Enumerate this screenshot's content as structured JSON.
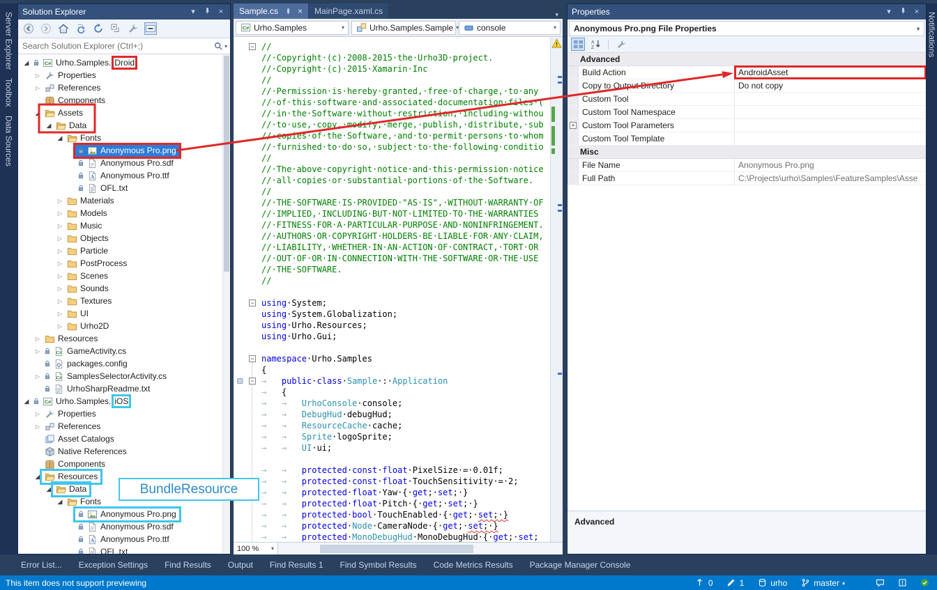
{
  "colors": {
    "chrome": "#29405F",
    "chrome_dark": "#1D3254",
    "titlebar": "#33517C",
    "statusbar": "#0079CC",
    "selection": "#2E7CD7",
    "annotation_red": "#E12727",
    "annotation_cyan": "#3FC6EC",
    "keyword_blue": "#0000EE",
    "type_teal": "#2B91AF",
    "comment_green": "#008000"
  },
  "glyphs": {
    "expanded": "◢",
    "collapsed": "▷",
    "caret_down": "▾",
    "caret_up": "▴",
    "fold": "−",
    "plus": "+",
    "close": "×",
    "window_position": "▾"
  },
  "side_tabs": {
    "left": [
      "Server Explorer",
      "Toolbox",
      "Data Sources"
    ],
    "right": [
      "Notifications"
    ]
  },
  "panel_buttons": [
    {
      "name": "window-position",
      "glyph": "▾"
    },
    {
      "name": "pin",
      "icon": "pin"
    },
    {
      "name": "close",
      "glyph": "×"
    }
  ],
  "solution_explorer": {
    "title": "Solution Explorer",
    "search_placeholder": "Search Solution Explorer (Ctrl+;)",
    "toolbar": [
      {
        "name": "back",
        "icon": "back"
      },
      {
        "name": "forward",
        "icon": "forward"
      },
      {
        "name": "home",
        "icon": "home"
      },
      {
        "name": "sync-with-active-document",
        "icon": "sync"
      },
      {
        "name": "refresh",
        "icon": "refresh"
      },
      {
        "name": "collapse-all",
        "icon": "collapse"
      },
      {
        "name": "properties",
        "icon": "wrench"
      },
      {
        "name": "preview-selected-items",
        "icon": "dash"
      }
    ],
    "tree": [
      {
        "label": "Urho.Samples.",
        "suffix": "Droid",
        "suffix_box": "red",
        "depth": 0,
        "icon": "proj",
        "exp": "open",
        "lock": 1
      },
      {
        "label": "Properties",
        "depth": 1,
        "icon": "wrench",
        "exp": "closed"
      },
      {
        "label": "References",
        "depth": 1,
        "icon": "refs",
        "exp": "closed"
      },
      {
        "label": "Components",
        "depth": 1,
        "icon": "package"
      },
      {
        "label": "Assets",
        "depth": 1,
        "icon": "folder-open",
        "exp": "open"
      },
      {
        "label": "Data",
        "depth": 2,
        "icon": "folder-open",
        "exp": "open"
      },
      {
        "label": "Fonts",
        "depth": 3,
        "icon": "folder-open",
        "exp": "open"
      },
      {
        "label": "Anonymous Pro.png",
        "depth": 4,
        "icon": "image",
        "lock": 1,
        "selected": 1,
        "box": "red"
      },
      {
        "label": "Anonymous Pro.sdf",
        "depth": 4,
        "icon": "file",
        "lock": 1
      },
      {
        "label": "Anonymous Pro.ttf",
        "depth": 4,
        "icon": "fontfile",
        "lock": 1
      },
      {
        "label": "OFL.txt",
        "depth": 4,
        "icon": "text",
        "lock": 1
      },
      {
        "label": "Materials",
        "depth": 3,
        "icon": "folder",
        "exp": "closed"
      },
      {
        "label": "Models",
        "depth": 3,
        "icon": "folder",
        "exp": "closed"
      },
      {
        "label": "Music",
        "depth": 3,
        "icon": "folder",
        "exp": "closed"
      },
      {
        "label": "Objects",
        "depth": 3,
        "icon": "folder",
        "exp": "closed"
      },
      {
        "label": "Particle",
        "depth": 3,
        "icon": "folder",
        "exp": "closed"
      },
      {
        "label": "PostProcess",
        "depth": 3,
        "icon": "folder",
        "exp": "closed"
      },
      {
        "label": "Scenes",
        "depth": 3,
        "icon": "folder",
        "exp": "closed"
      },
      {
        "label": "Sounds",
        "depth": 3,
        "icon": "folder",
        "exp": "closed"
      },
      {
        "label": "Textures",
        "depth": 3,
        "icon": "folder",
        "exp": "closed"
      },
      {
        "label": "UI",
        "depth": 3,
        "icon": "folder",
        "exp": "closed"
      },
      {
        "label": "Urho2D",
        "depth": 3,
        "icon": "folder",
        "exp": "closed"
      },
      {
        "label": "Resources",
        "depth": 1,
        "icon": "folder",
        "exp": "closed"
      },
      {
        "label": "GameActivity.cs",
        "depth": 1,
        "icon": "cs",
        "exp": "closed",
        "lock": 1
      },
      {
        "label": "packages.config",
        "depth": 1,
        "icon": "config",
        "lock": 1
      },
      {
        "label": "SamplesSelectorActivity.cs",
        "depth": 1,
        "icon": "cs",
        "exp": "closed",
        "lock": 1
      },
      {
        "label": "UrhoSharpReadme.txt",
        "depth": 1,
        "icon": "text",
        "lock": 1
      },
      {
        "label": "Urho.Samples.",
        "suffix": "iOS",
        "suffix_box": "cyan",
        "depth": 0,
        "icon": "proj",
        "exp": "open",
        "lock": 1
      },
      {
        "label": "Properties",
        "depth": 1,
        "icon": "wrench",
        "exp": "closed"
      },
      {
        "label": "References",
        "depth": 1,
        "icon": "refs",
        "exp": "closed"
      },
      {
        "label": "Asset Catalogs",
        "depth": 1,
        "icon": "catalog"
      },
      {
        "label": "Native References",
        "depth": 1,
        "icon": "cube"
      },
      {
        "label": "Components",
        "depth": 1,
        "icon": "package"
      },
      {
        "label": "Resources",
        "depth": 1,
        "icon": "folder-open",
        "exp": "open",
        "box": "cyan"
      },
      {
        "label": "Data",
        "depth": 2,
        "icon": "folder-open",
        "exp": "open",
        "box": "cyan"
      },
      {
        "label": "Fonts",
        "depth": 3,
        "icon": "folder-open",
        "exp": "open"
      },
      {
        "label": "Anonymous Pro.png",
        "depth": 4,
        "icon": "image",
        "lock": 1,
        "box": "cyan"
      },
      {
        "label": "Anonymous Pro.sdf",
        "depth": 4,
        "icon": "file",
        "lock": 1
      },
      {
        "label": "Anonymous Pro.ttf",
        "depth": 4,
        "icon": "fontfile",
        "lock": 1
      },
      {
        "label": "OFL.txt",
        "depth": 4,
        "icon": "text",
        "lock": 1
      }
    ]
  },
  "editor": {
    "tabs": [
      {
        "label": "Sample.cs",
        "active": true
      },
      {
        "label": "MainPage.xaml.cs",
        "active": false
      }
    ],
    "navbar": [
      {
        "name": "project",
        "icon": "proj",
        "label": "Urho.Samples"
      },
      {
        "name": "type",
        "icon": "class",
        "label": "Urho.Samples.Sample"
      },
      {
        "name": "member",
        "icon": "field",
        "label": "console"
      }
    ],
    "zoom": "100 %",
    "code": [
      {
        "f": 1,
        "s": [
          [
            "cm",
            "//"
          ]
        ]
      },
      {
        "s": [
          [
            "cm",
            "//·Copyright·(c)·2008-2015·the·Urho3D·project."
          ]
        ]
      },
      {
        "s": [
          [
            "cm",
            "//·Copyright·(c)·2015·Xamarin·Inc"
          ]
        ]
      },
      {
        "s": [
          [
            "cm",
            "//"
          ]
        ]
      },
      {
        "s": [
          [
            "cm",
            "//·Permission·is·hereby·granted,·free·of·charge,·to·any"
          ]
        ]
      },
      {
        "s": [
          [
            "cm",
            "//·of·this·software·and·associated·documentation·files·("
          ]
        ]
      },
      {
        "s": [
          [
            "cm",
            "//·in·the·Software·without·restriction,·including·withou"
          ]
        ]
      },
      {
        "s": [
          [
            "cm",
            "//·to·use,·copy,·modify,·merge,·publish,·distribute,·sub"
          ]
        ]
      },
      {
        "s": [
          [
            "cm",
            "//·copies·of·the·Software,·and·to·permit·persons·to·whom"
          ]
        ]
      },
      {
        "s": [
          [
            "cm",
            "//·furnished·to·do·so,·subject·to·the·following·conditio"
          ]
        ]
      },
      {
        "s": [
          [
            "cm",
            "//"
          ]
        ]
      },
      {
        "s": [
          [
            "cm",
            "//·The·above·copyright·notice·and·this·permission·notice"
          ]
        ]
      },
      {
        "s": [
          [
            "cm",
            "//·all·copies·or·substantial·portions·of·the·Software."
          ]
        ]
      },
      {
        "s": [
          [
            "cm",
            "//"
          ]
        ]
      },
      {
        "s": [
          [
            "cm",
            "//·THE·SOFTWARE·IS·PROVIDED·\"AS·IS\",·WITHOUT·WARRANTY·OF"
          ]
        ]
      },
      {
        "s": [
          [
            "cm",
            "//·IMPLIED,·INCLUDING·BUT·NOT·LIMITED·TO·THE·WARRANTIES"
          ]
        ]
      },
      {
        "s": [
          [
            "cm",
            "//·FITNESS·FOR·A·PARTICULAR·PURPOSE·AND·NONINFRINGEMENT."
          ]
        ]
      },
      {
        "s": [
          [
            "cm",
            "//·AUTHORS·OR·COPYRIGHT·HOLDERS·BE·LIABLE·FOR·ANY·CLAIM,"
          ]
        ]
      },
      {
        "s": [
          [
            "cm",
            "//·LIABILITY,·WHETHER·IN·AN·ACTION·OF·CONTRACT,·TORT·OR"
          ]
        ]
      },
      {
        "s": [
          [
            "cm",
            "//·OUT·OF·OR·IN·CONNECTION·WITH·THE·SOFTWARE·OR·THE·USE"
          ]
        ]
      },
      {
        "s": [
          [
            "cm",
            "//·THE·SOFTWARE."
          ]
        ]
      },
      {
        "s": [
          [
            "cm",
            "//"
          ]
        ]
      },
      {
        "s": []
      },
      {
        "f": 1,
        "s": [
          [
            "kw",
            "using"
          ],
          [
            "tx",
            "·System;"
          ]
        ]
      },
      {
        "s": [
          [
            "kw",
            "using"
          ],
          [
            "tx",
            "·System.Globalization;"
          ]
        ]
      },
      {
        "s": [
          [
            "kw",
            "using"
          ],
          [
            "tx",
            "·Urho.Resources;"
          ]
        ]
      },
      {
        "s": [
          [
            "kw",
            "using"
          ],
          [
            "tx",
            "·Urho.Gui;"
          ]
        ]
      },
      {
        "s": []
      },
      {
        "f": 1,
        "s": [
          [
            "kw",
            "namespace"
          ],
          [
            "tx",
            "·Urho.Samples"
          ]
        ]
      },
      {
        "s": [
          [
            "tx",
            "{"
          ]
        ]
      },
      {
        "f": 1,
        "g": 1,
        "s": [
          [
            "ws",
            "→   "
          ],
          [
            "kw",
            "public"
          ],
          [
            "tx",
            "·"
          ],
          [
            "kw",
            "class"
          ],
          [
            "tx",
            "·"
          ],
          [
            "ty",
            "Sample"
          ],
          [
            "tx",
            "·:·"
          ],
          [
            "ty",
            "Application"
          ]
        ]
      },
      {
        "s": [
          [
            "ws",
            "→   "
          ],
          [
            "tx",
            "{"
          ]
        ]
      },
      {
        "s": [
          [
            "ws",
            "→   →   "
          ],
          [
            "ty",
            "UrhoConsole"
          ],
          [
            "tx",
            "·console;"
          ]
        ]
      },
      {
        "s": [
          [
            "ws",
            "→   →   "
          ],
          [
            "ty",
            "DebugHud"
          ],
          [
            "tx",
            "·debugHud;"
          ]
        ]
      },
      {
        "s": [
          [
            "ws",
            "→   →   "
          ],
          [
            "ty",
            "ResourceCache"
          ],
          [
            "tx",
            "·cache;"
          ]
        ]
      },
      {
        "s": [
          [
            "ws",
            "→   →   "
          ],
          [
            "ty",
            "Sprite"
          ],
          [
            "tx",
            "·logoSprite;"
          ]
        ]
      },
      {
        "s": [
          [
            "ws",
            "→   →   "
          ],
          [
            "ty",
            "UI"
          ],
          [
            "tx",
            "·ui;"
          ]
        ]
      },
      {
        "s": []
      },
      {
        "s": [
          [
            "ws",
            "→   →   "
          ],
          [
            "kw",
            "protected"
          ],
          [
            "tx",
            "·"
          ],
          [
            "kw",
            "const"
          ],
          [
            "tx",
            "·"
          ],
          [
            "kw",
            "float"
          ],
          [
            "tx",
            "·PixelSize·=·0.01f;"
          ]
        ]
      },
      {
        "s": [
          [
            "ws",
            "→   →   "
          ],
          [
            "kw",
            "protected"
          ],
          [
            "tx",
            "·"
          ],
          [
            "kw",
            "const"
          ],
          [
            "tx",
            "·"
          ],
          [
            "kw",
            "float"
          ],
          [
            "tx",
            "·TouchSensitivity·=·2;"
          ]
        ]
      },
      {
        "s": [
          [
            "ws",
            "→   →   "
          ],
          [
            "kw",
            "protected"
          ],
          [
            "tx",
            "·"
          ],
          [
            "kw",
            "float"
          ],
          [
            "tx",
            "·Yaw·{·"
          ],
          [
            "kw",
            "get"
          ],
          [
            "tx",
            ";·"
          ],
          [
            "kw",
            "set"
          ],
          [
            "tx",
            ";·}"
          ]
        ]
      },
      {
        "s": [
          [
            "ws",
            "→   →   "
          ],
          [
            "kw",
            "protected"
          ],
          [
            "tx",
            "·"
          ],
          [
            "kw",
            "float"
          ],
          [
            "tx",
            "·Pitch·{·"
          ],
          [
            "kw",
            "get"
          ],
          [
            "tx",
            ";·"
          ],
          [
            "kw",
            "set"
          ],
          [
            "tx",
            ";·}"
          ]
        ]
      },
      {
        "s": [
          [
            "ws",
            "→   →   "
          ],
          [
            "kw",
            "protected"
          ],
          [
            "tx",
            "·"
          ],
          [
            "kw",
            "bool"
          ],
          [
            "tx",
            "·TouchEnabled·{·"
          ],
          [
            "kw",
            "get"
          ],
          [
            "tx",
            ";·"
          ],
          [
            "kw sq",
            "set"
          ],
          [
            "tx sq",
            ";·}"
          ]
        ]
      },
      {
        "s": [
          [
            "ws",
            "→   →   "
          ],
          [
            "kw",
            "protected"
          ],
          [
            "tx",
            "·"
          ],
          [
            "ty",
            "Node"
          ],
          [
            "tx",
            "·CameraNode·{·"
          ],
          [
            "kw",
            "get"
          ],
          [
            "tx",
            ";·"
          ],
          [
            "kw sq",
            "set"
          ],
          [
            "tx sq",
            ";·}"
          ]
        ]
      },
      {
        "s": [
          [
            "ws",
            "→   →   "
          ],
          [
            "kw sq",
            "protected"
          ],
          [
            "tx",
            "·"
          ],
          [
            "ty sq",
            "MonoDebugHud"
          ],
          [
            "tx",
            "·MonoDebugHud·{·"
          ],
          [
            "kw",
            "get"
          ],
          [
            "tx",
            ";·"
          ],
          [
            "kw",
            "set"
          ],
          [
            "tx",
            ";"
          ]
        ]
      }
    ]
  },
  "properties": {
    "title": "Properties",
    "object": "Anonymous Pro.png File Properties",
    "toolbar": [
      {
        "name": "categorized",
        "icon": "categorized",
        "selected": true
      },
      {
        "name": "alphabetical",
        "icon": "az",
        "selected": false
      },
      {
        "name": "property-pages",
        "icon": "wrench",
        "selected": false
      }
    ],
    "groups": [
      {
        "name": "Advanced",
        "rows": [
          {
            "n": "Build Action",
            "v": "AndroidAsset",
            "box": "red"
          },
          {
            "n": "Copy to Output Directory",
            "v": "Do not copy"
          },
          {
            "n": "Custom Tool",
            "v": ""
          },
          {
            "n": "Custom Tool Namespace",
            "v": ""
          },
          {
            "n": "Custom Tool Parameters",
            "v": "",
            "expand": 1
          },
          {
            "n": "Custom Tool Template",
            "v": ""
          }
        ]
      },
      {
        "name": "Misc",
        "rows": [
          {
            "n": "File Name",
            "v": "Anonymous Pro.png",
            "muted": 1
          },
          {
            "n": "Full Path",
            "v": "C:\\Projects\\urho\\Samples\\FeatureSamples\\Asse",
            "muted": 1
          }
        ]
      }
    ],
    "description": "Advanced"
  },
  "bottom_tabs": [
    "Error List...",
    "Exception Settings",
    "Find Results",
    "Output",
    "Find Results 1",
    "Find Symbol Results",
    "Code Metrics Results",
    "Package Manager Console"
  ],
  "status_bar": {
    "message": "This item does not support previewing",
    "items": [
      {
        "name": "unpushed-commits",
        "icon": "arrow-up",
        "label": "0"
      },
      {
        "name": "pending-edits",
        "icon": "pencil",
        "label": "1"
      },
      {
        "name": "repository",
        "icon": "repo",
        "label": "urho"
      },
      {
        "name": "branch",
        "icon": "branch",
        "label": "master",
        "caret": true
      }
    ],
    "right_icons": [
      {
        "name": "feedback",
        "icon": "chat"
      },
      {
        "name": "notifications",
        "icon": "alert"
      },
      {
        "name": "status-ok",
        "icon": "check"
      }
    ]
  },
  "annotations": {
    "bundle_label": "BundleResource"
  }
}
